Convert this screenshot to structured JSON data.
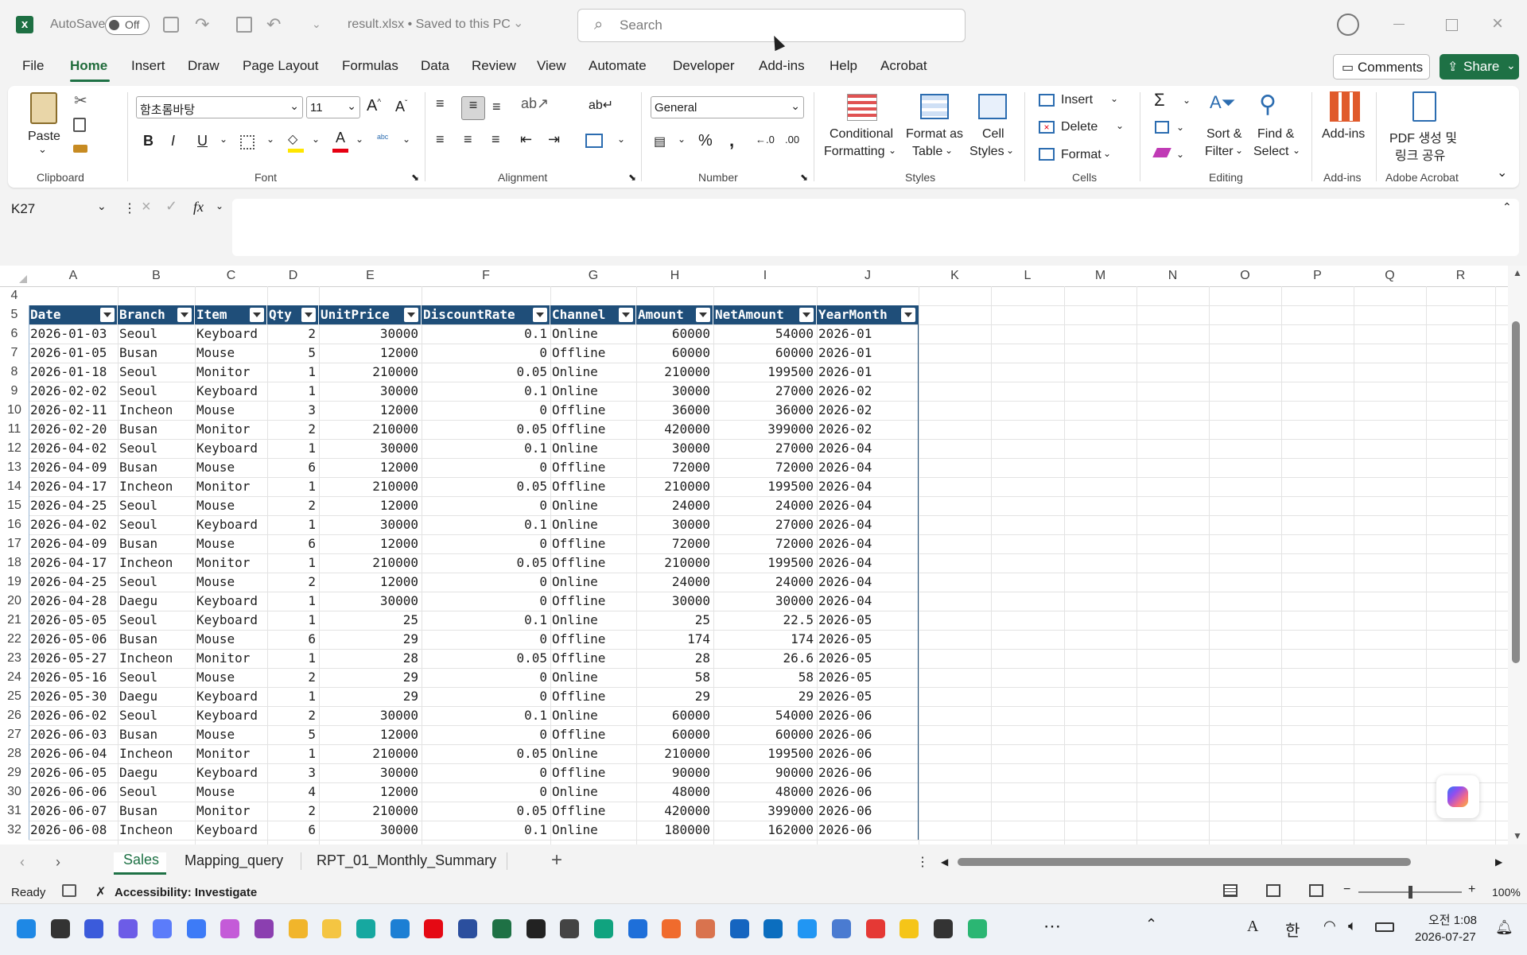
{
  "titlebar": {
    "autosave_label": "AutoSave",
    "autosave_state": "Off",
    "filename": "result.xlsx • Saved to this PC",
    "search_placeholder": "Search"
  },
  "menu": {
    "tabs": [
      "File",
      "Home",
      "Insert",
      "Draw",
      "Page Layout",
      "Formulas",
      "Data",
      "Review",
      "View",
      "Automate",
      "Developer",
      "Add-ins",
      "Help",
      "Acrobat"
    ],
    "comments": "Comments",
    "share": "Share"
  },
  "ribbon": {
    "paste": "Paste",
    "font_name": "함초롬바탕",
    "font_size": "11",
    "number_format": "General",
    "conditional_formatting": [
      "Conditional",
      "Formatting"
    ],
    "format_as_table": [
      "Format as",
      "Table"
    ],
    "cell_styles": [
      "Cell",
      "Styles"
    ],
    "insert": "Insert",
    "delete": "Delete",
    "format": "Format",
    "sort_filter": [
      "Sort &",
      "Filter"
    ],
    "find_select": [
      "Find &",
      "Select"
    ],
    "addins": "Add-ins",
    "pdf": [
      "PDF 생성 및",
      "링크 공유"
    ],
    "groups": {
      "clipboard": "Clipboard",
      "font": "Font",
      "alignment": "Alignment",
      "number": "Number",
      "styles": "Styles",
      "cells": "Cells",
      "editing": "Editing",
      "addins": "Add-ins",
      "acrobat": "Adobe Acrobat"
    }
  },
  "formula_bar": {
    "name_box": "K27",
    "fx": "fx",
    "formula": ""
  },
  "columns": [
    "A",
    "B",
    "C",
    "D",
    "E",
    "F",
    "G",
    "H",
    "I",
    "J",
    "K",
    "L",
    "M",
    "N",
    "O",
    "P",
    "Q",
    "R"
  ],
  "table": {
    "headers": [
      "Date",
      "Branch",
      "Item",
      "Qty",
      "UnitPrice",
      "DiscountRate",
      "Channel",
      "Amount",
      "NetAmount",
      "YearMonth"
    ],
    "rows": [
      [
        "2026-01-03",
        "Seoul",
        "Keyboard",
        "2",
        "30000",
        "0.1",
        "Online",
        "60000",
        "54000",
        "2026-01"
      ],
      [
        "2026-01-05",
        "Busan",
        "Mouse",
        "5",
        "12000",
        "0",
        "Offline",
        "60000",
        "60000",
        "2026-01"
      ],
      [
        "2026-01-18",
        "Seoul",
        "Monitor",
        "1",
        "210000",
        "0.05",
        "Online",
        "210000",
        "199500",
        "2026-01"
      ],
      [
        "2026-02-02",
        "Seoul",
        "Keyboard",
        "1",
        "30000",
        "0.1",
        "Online",
        "30000",
        "27000",
        "2026-02"
      ],
      [
        "2026-02-11",
        "Incheon",
        "Mouse",
        "3",
        "12000",
        "0",
        "Offline",
        "36000",
        "36000",
        "2026-02"
      ],
      [
        "2026-02-20",
        "Busan",
        "Monitor",
        "2",
        "210000",
        "0.05",
        "Offline",
        "420000",
        "399000",
        "2026-02"
      ],
      [
        "2026-04-02",
        "Seoul",
        "Keyboard",
        "1",
        "30000",
        "0.1",
        "Online",
        "30000",
        "27000",
        "2026-04"
      ],
      [
        "2026-04-09",
        "Busan",
        "Mouse",
        "6",
        "12000",
        "0",
        "Offline",
        "72000",
        "72000",
        "2026-04"
      ],
      [
        "2026-04-17",
        "Incheon",
        "Monitor",
        "1",
        "210000",
        "0.05",
        "Offline",
        "210000",
        "199500",
        "2026-04"
      ],
      [
        "2026-04-25",
        "Seoul",
        "Mouse",
        "2",
        "12000",
        "0",
        "Online",
        "24000",
        "24000",
        "2026-04"
      ],
      [
        "2026-04-02",
        "Seoul",
        "Keyboard",
        "1",
        "30000",
        "0.1",
        "Online",
        "30000",
        "27000",
        "2026-04"
      ],
      [
        "2026-04-09",
        "Busan",
        "Mouse",
        "6",
        "12000",
        "0",
        "Offline",
        "72000",
        "72000",
        "2026-04"
      ],
      [
        "2026-04-17",
        "Incheon",
        "Monitor",
        "1",
        "210000",
        "0.05",
        "Offline",
        "210000",
        "199500",
        "2026-04"
      ],
      [
        "2026-04-25",
        "Seoul",
        "Mouse",
        "2",
        "12000",
        "0",
        "Online",
        "24000",
        "24000",
        "2026-04"
      ],
      [
        "2026-04-28",
        "Daegu",
        "Keyboard",
        "1",
        "30000",
        "0",
        "Offline",
        "30000",
        "30000",
        "2026-04"
      ],
      [
        "2026-05-05",
        "Seoul",
        "Keyboard",
        "1",
        "25",
        "0.1",
        "Online",
        "25",
        "22.5",
        "2026-05"
      ],
      [
        "2026-05-06",
        "Busan",
        "Mouse",
        "6",
        "29",
        "0",
        "Offline",
        "174",
        "174",
        "2026-05"
      ],
      [
        "2026-05-27",
        "Incheon",
        "Monitor",
        "1",
        "28",
        "0.05",
        "Offline",
        "28",
        "26.6",
        "2026-05"
      ],
      [
        "2026-05-16",
        "Seoul",
        "Mouse",
        "2",
        "29",
        "0",
        "Online",
        "58",
        "58",
        "2026-05"
      ],
      [
        "2026-05-30",
        "Daegu",
        "Keyboard",
        "1",
        "29",
        "0",
        "Offline",
        "29",
        "29",
        "2026-05"
      ],
      [
        "2026-06-02",
        "Seoul",
        "Keyboard",
        "2",
        "30000",
        "0.1",
        "Online",
        "60000",
        "54000",
        "2026-06"
      ],
      [
        "2026-06-03",
        "Busan",
        "Mouse",
        "5",
        "12000",
        "0",
        "Offline",
        "60000",
        "60000",
        "2026-06"
      ],
      [
        "2026-06-04",
        "Incheon",
        "Monitor",
        "1",
        "210000",
        "0.05",
        "Online",
        "210000",
        "199500",
        "2026-06"
      ],
      [
        "2026-06-05",
        "Daegu",
        "Keyboard",
        "3",
        "30000",
        "0",
        "Offline",
        "90000",
        "90000",
        "2026-06"
      ],
      [
        "2026-06-06",
        "Seoul",
        "Mouse",
        "4",
        "12000",
        "0",
        "Online",
        "48000",
        "48000",
        "2026-06"
      ],
      [
        "2026-06-07",
        "Busan",
        "Monitor",
        "2",
        "210000",
        "0.05",
        "Offline",
        "420000",
        "399000",
        "2026-06"
      ],
      [
        "2026-06-08",
        "Incheon",
        "Keyboard",
        "6",
        "30000",
        "0.1",
        "Online",
        "180000",
        "162000",
        "2026-06"
      ]
    ]
  },
  "sheets": [
    "Sales",
    "Mapping_query",
    "RPT_01_Monthly_Summary"
  ],
  "status": {
    "ready": "Ready",
    "accessibility": "Accessibility: Investigate",
    "zoom": "100%"
  },
  "taskbar": {
    "time": "오전 1:08",
    "date": "2026-07-27",
    "ime": "한",
    "ime2": "A"
  }
}
